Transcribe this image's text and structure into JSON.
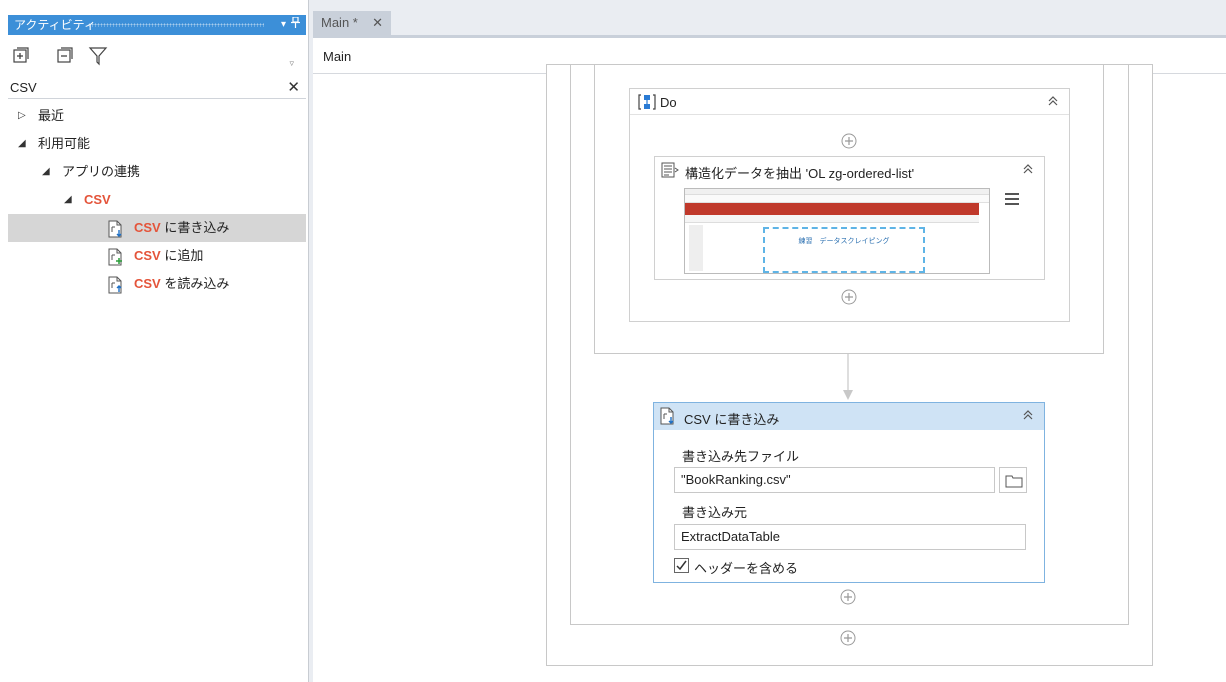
{
  "panel": {
    "title": "アクティビティ",
    "search_value": "CSV"
  },
  "tree": {
    "recent": "最近",
    "available": "利用可能",
    "app_integration": "アプリの連携",
    "csv_group": "CSV",
    "items": [
      {
        "hl": "CSV",
        "rest": " に書き込み"
      },
      {
        "hl": "CSV",
        "rest": " に追加"
      },
      {
        "hl": "CSV",
        "rest": " を読み込み"
      }
    ]
  },
  "tabs": [
    {
      "label": "Main *"
    }
  ],
  "breadcrumb": "Main",
  "workflow": {
    "do_title": "Do",
    "extract_title": "構造化データを抽出 'OL  zg-ordered-list'",
    "thumbnail_text": "練習　データスクレイピング",
    "write_csv": {
      "title": "CSV に書き込み",
      "file_label": "書き込み先ファイル",
      "file_value": "\"BookRanking.csv\"",
      "source_label": "書き込み元",
      "source_value": "ExtractDataTable",
      "header_checkbox_label": "ヘッダーを含める",
      "header_checked": true
    }
  },
  "colors": {
    "panel_title_bg": "#3c8fd8",
    "highlight": "#e4543a",
    "selected_row": "#d6d6d6",
    "activity_header_selected": "#cfe3f5",
    "activity_border_selected": "#7fb3e0"
  }
}
